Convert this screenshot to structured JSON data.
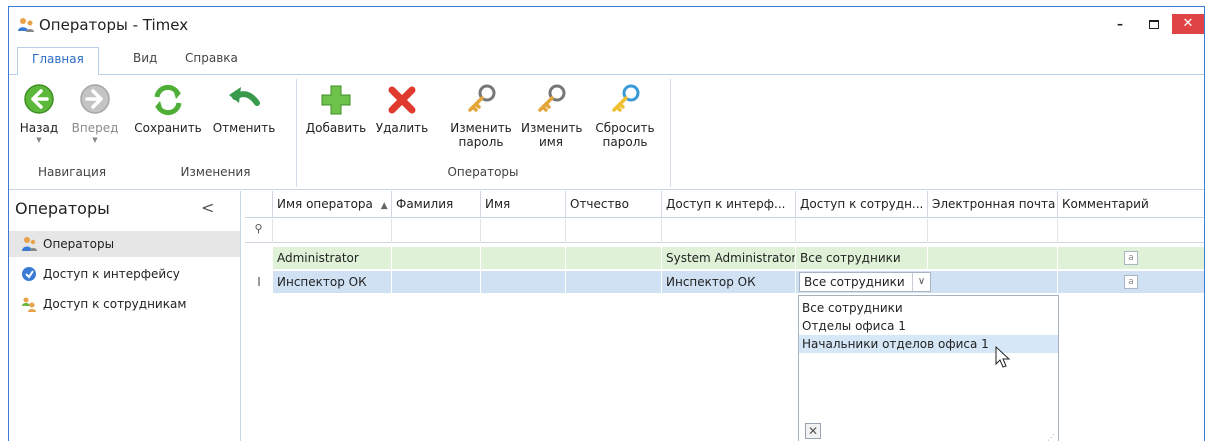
{
  "window": {
    "title": "Операторы - Timex",
    "min_label": "–",
    "close_label": "✕"
  },
  "tabs": [
    "Главная",
    "Вид",
    "Справка"
  ],
  "ribbon": {
    "buttons": {
      "back": "Назад",
      "forward": "Вперед",
      "save": "Сохранить",
      "cancel": "Отменить",
      "add": "Добавить",
      "delete": "Удалить",
      "change_password_1": "Изменить",
      "change_password_2": "пароль",
      "change_name_1": "Изменить",
      "change_name_2": "имя",
      "reset_password_1": "Сбросить",
      "reset_password_2": "пароль"
    },
    "groups": {
      "navigation": "Навигация",
      "changes": "Изменения",
      "operators": "Операторы"
    }
  },
  "nav": {
    "title": "Операторы",
    "collapse": "<",
    "items": [
      "Операторы",
      "Доступ к интерфейсу",
      "Доступ к сотрудникам"
    ]
  },
  "grid": {
    "columns": [
      "Имя оператора",
      "Фамилия",
      "Имя",
      "Отчество",
      "Доступ к интерф...",
      "Доступ к сотрудн...",
      "Электронная почта",
      "Комментарий"
    ],
    "sort_indicator": "▲",
    "filter_icon": "⚲",
    "rows": [
      {
        "name": "Administrator",
        "surname": "",
        "first": "",
        "patronymic": "",
        "ui_access": "System Administrator",
        "emp_access": "Все сотрудники",
        "email": ""
      },
      {
        "name": "Инспектор ОК",
        "surname": "",
        "first": "",
        "patronymic": "",
        "ui_access": "Инспектор ОК",
        "emp_access": "Все сотрудники",
        "email": ""
      }
    ],
    "edit_indicator": "I",
    "note_glyph": "a"
  },
  "dropdown": {
    "options": [
      "Все сотрудники",
      "Отделы офиса 1",
      "Начальники отделов офиса 1"
    ],
    "highlighted_index": 2,
    "close_glyph": "✕",
    "toggle_glyph": "∨"
  },
  "colors": {
    "accent": "#2b6cc4",
    "row_green": "#dff2d8",
    "row_blue": "#cfe1f3",
    "close_red": "#e04343"
  }
}
